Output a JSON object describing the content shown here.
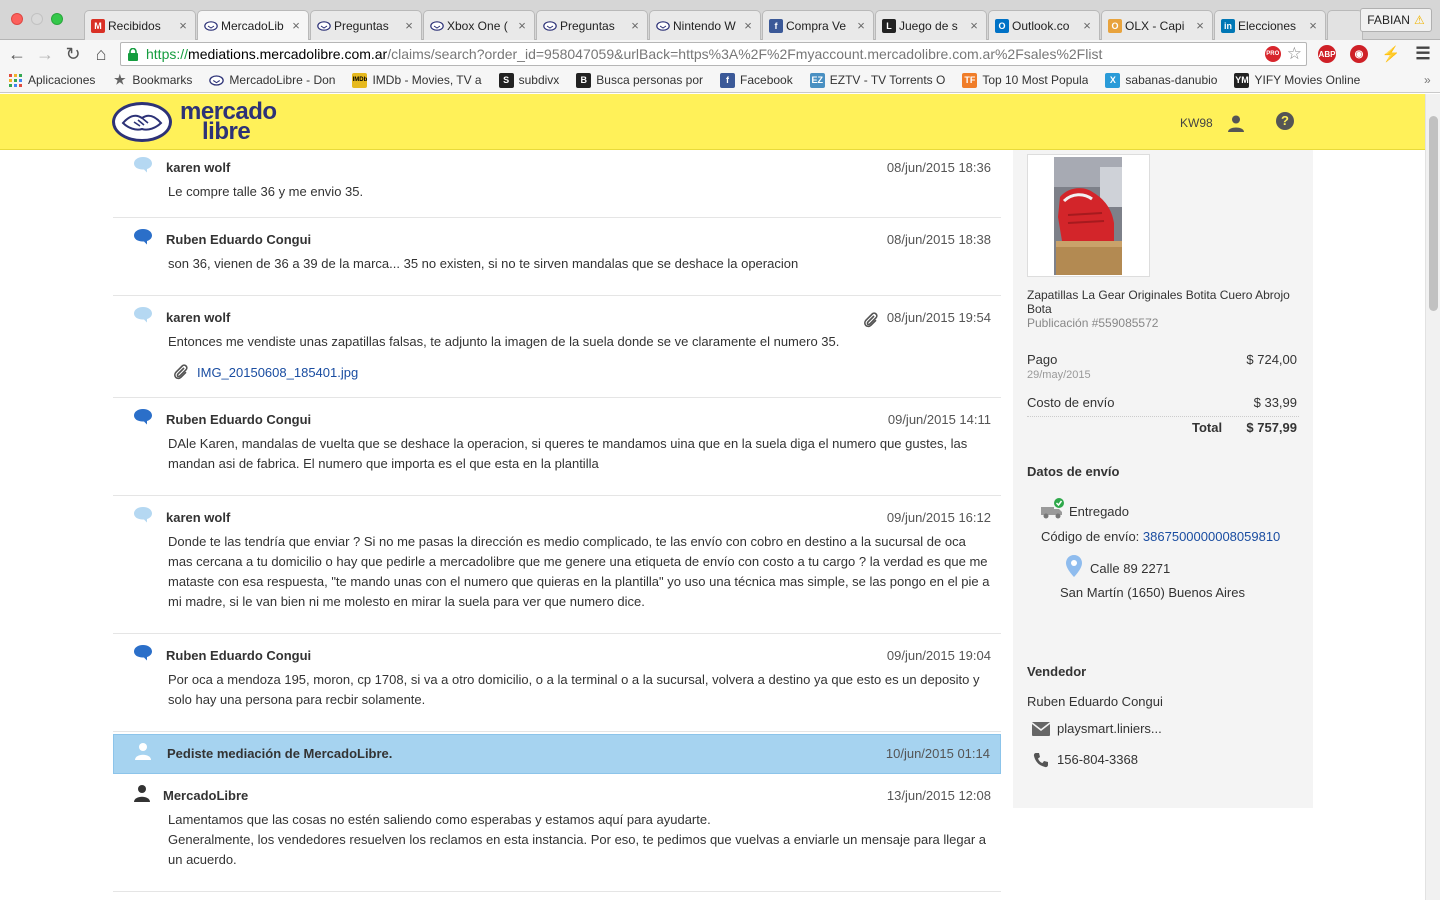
{
  "browser": {
    "tabs": [
      {
        "title": "Recibidos",
        "icon": "gmail-icon",
        "color": "#d93025",
        "glyph": "M"
      },
      {
        "title": "MercadoLib",
        "icon": "mercadolibre-icon",
        "color": "#f5e31b",
        "glyph": "",
        "active": true
      },
      {
        "title": "Preguntas",
        "icon": "mercadolibre-icon",
        "color": "#f5e31b",
        "glyph": ""
      },
      {
        "title": "Xbox One (",
        "icon": "mercadolibre-icon",
        "color": "#f5e31b",
        "glyph": ""
      },
      {
        "title": "Preguntas",
        "icon": "mercadolibre-icon",
        "color": "#f5e31b",
        "glyph": ""
      },
      {
        "title": "Nintendo W",
        "icon": "mercadolibre-icon",
        "color": "#f5e31b",
        "glyph": ""
      },
      {
        "title": "Compra Ve",
        "icon": "facebook-icon",
        "color": "#3b5998",
        "glyph": "f"
      },
      {
        "title": "Juego de s",
        "icon": "letter-l-icon",
        "color": "#222222",
        "glyph": "L"
      },
      {
        "title": "Outlook.co",
        "icon": "outlook-icon",
        "color": "#0072c6",
        "glyph": "O"
      },
      {
        "title": "OLX - Capi",
        "icon": "olx-icon",
        "color": "#e8a33d",
        "glyph": "O"
      },
      {
        "title": "Elecciones",
        "icon": "linkedin-icon",
        "color": "#0077b5",
        "glyph": "in"
      }
    ],
    "profile": "FABIAN",
    "url_proto": "https://",
    "url_host": "mediations.mercadolibre.com.ar",
    "url_rest": "/claims/search?order_id=958047059&urlBack=https%3A%2F%2Fmyaccount.mercadolibre.com.ar%2Fsales%2Flist",
    "bookmarks": [
      {
        "label": "Aplicaciones",
        "icon": "apps-grid-icon",
        "color": "#e04a3f",
        "glyph": "⋮"
      },
      {
        "label": "Bookmarks",
        "icon": "star-icon",
        "color": "#666666",
        "glyph": "★"
      },
      {
        "label": "MercadoLibre - Don",
        "icon": "mercadolibre-icon",
        "color": "#f5e31b",
        "glyph": ""
      },
      {
        "label": "IMDb - Movies, TV a",
        "icon": "imdb-icon",
        "color": "#e6b91e",
        "glyph": "IMDb"
      },
      {
        "label": "subdivx",
        "icon": "subdivx-icon",
        "color": "#222222",
        "glyph": "S"
      },
      {
        "label": "Busca personas por",
        "icon": "letter-b-icon",
        "color": "#222222",
        "glyph": "B"
      },
      {
        "label": "Facebook",
        "icon": "facebook-icon",
        "color": "#3b5998",
        "glyph": "f"
      },
      {
        "label": "EZTV - TV Torrents O",
        "icon": "eztv-icon",
        "color": "#4a90c2",
        "glyph": "EZ"
      },
      {
        "label": "Top 10 Most Popula",
        "icon": "tf-icon",
        "color": "#f07d29",
        "glyph": "TF"
      },
      {
        "label": "sabanas-danubio",
        "icon": "x-icon",
        "color": "#2a9bd8",
        "glyph": "X"
      },
      {
        "label": "YIFY Movies Online",
        "icon": "ym-icon",
        "color": "#222222",
        "glyph": "YM"
      }
    ]
  },
  "header": {
    "logo_line1": "mercado",
    "logo_line2": "libre",
    "username": "KW98"
  },
  "messages": [
    {
      "author": "karen wolf",
      "role": "buyer",
      "date": "08/jun/2015 18:36",
      "lines": [
        "Le compre talle 36 y me envio 35."
      ]
    },
    {
      "author": "Ruben Eduardo Congui",
      "role": "seller",
      "date": "08/jun/2015 18:38",
      "lines": [
        "son 36, vienen de 36 a 39 de la marca... 35 no existen, si no te sirven mandalas que se deshace la operacion"
      ]
    },
    {
      "author": "karen wolf",
      "role": "buyer",
      "date": "08/jun/2015 19:54",
      "has_clip": true,
      "lines": [
        "Entonces me vendiste unas zapatillas falsas, te adjunto la imagen de la suela donde se ve claramente el numero 35."
      ],
      "attachment": "IMG_20150608_185401.jpg"
    },
    {
      "author": "Ruben Eduardo Congui",
      "role": "seller",
      "date": "09/jun/2015 14:11",
      "lines": [
        "DAle Karen, mandalas de vuelta que se deshace la operacion, si queres te mandamos uina que en la suela diga el numero que gustes, las",
        "mandan asi de fabrica. El numero que importa es el que esta en la plantilla"
      ]
    },
    {
      "author": "karen wolf",
      "role": "buyer",
      "date": "09/jun/2015 16:12",
      "lines": [
        "Donde te las tendría que enviar ? Si no me pasas la dirección es medio complicado, te las envío con cobro en destino a la sucursal de oca",
        "mas cercana a tu domicilio o hay que pedirle a mercadolibre que me genere una etiqueta de envío con costo a tu cargo ? la verdad es que me",
        "mataste con esa respuesta, \"te mando unas con el numero que quieras en la plantilla\" yo uso una técnica mas simple, se las pongo en el pie a",
        "mi madre, si le van bien ni me molesto en mirar la suela para ver que numero dice."
      ]
    },
    {
      "author": "Ruben Eduardo Congui",
      "role": "seller",
      "date": "09/jun/2015 19:04",
      "lines": [
        "Por oca a mendoza 195, moron, cp 1708, si va a otro domicilio, o a la terminal o a la sucursal, volvera a destino ya que esto es un deposito y",
        "solo hay una persona para recbir solamente."
      ]
    },
    {
      "author": "Pediste mediación de MercadoLibre.",
      "role": "system",
      "date": "10/jun/2015 01:14",
      "lines": []
    },
    {
      "author": "MercadoLibre",
      "role": "mercadolibre",
      "date": "13/jun/2015 12:08",
      "lines": [
        "Lamentamos que las cosas no estén saliendo como esperabas y estamos aquí para ayudarte.",
        "Generalmente, los vendedores resuelven los reclamos en esta instancia. Por eso, te pedimos que vuelvas a enviarle un mensaje para llegar a",
        "un acuerdo."
      ]
    }
  ],
  "side": {
    "product_title": "Zapatillas La Gear Originales Botita Cuero Abrojo Bota",
    "publication": "Publicación #559085572",
    "pago_label": "Pago",
    "pago_value": "$ 724,00",
    "pago_date": "29/may/2015",
    "envio_label": "Costo de envío",
    "envio_value": "$ 33,99",
    "total_label": "Total",
    "total_value": "$ 757,99",
    "shipping_header": "Datos de envío",
    "status": "Entregado",
    "code_label": "Código de envío:",
    "code_value": "3867500000008059810",
    "address_line1": "Calle 89 2271",
    "address_line2": "San Martín (1650) Buenos Aires",
    "seller_header": "Vendedor",
    "seller_name": "Ruben Eduardo Congui",
    "seller_email": "playsmart.liniers...",
    "seller_phone": "156-804-3368"
  },
  "colors": {
    "ml_yellow": "#fff159",
    "ml_blue": "#2d3277",
    "highlight": "#a6d3f0",
    "link": "#1a4da1",
    "buyer_bubble": "#b5d8f2",
    "seller_bubble": "#2b6fc9",
    "delivered_check": "#2ea84a"
  }
}
